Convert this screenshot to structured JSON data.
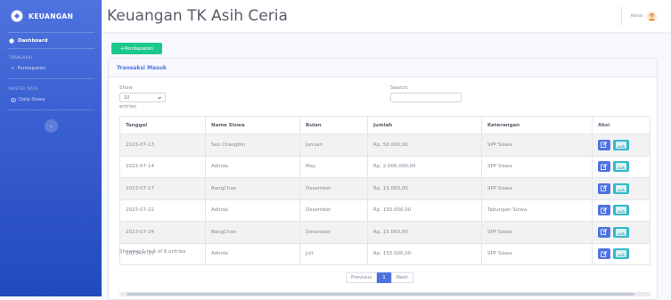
{
  "brand": {
    "name": "KEUANGAN"
  },
  "sidebar": {
    "dashboard": "Dashboard",
    "heading_transaksi": "TRANSAKSI",
    "pendapatan": "Pendapatan",
    "heading_master": "MASTER DATA",
    "data_siswa": "Data Siswa",
    "toggle_icon": "chevron-left"
  },
  "header": {
    "title": "Keuangan TK Asih Ceria",
    "user": "Admin"
  },
  "toolbar": {
    "add_label": "+Pendapatan"
  },
  "card": {
    "title": "Transaksi Masuk"
  },
  "controls": {
    "show_label": "Show",
    "length_value": "10",
    "entries_label": "entries",
    "search_label": "Search:"
  },
  "table": {
    "headers": [
      "Tanggal",
      "Nama Siswa",
      "Bulan",
      "Jumlah",
      "Keterangan",
      "Aksi"
    ],
    "rows": [
      [
        "2023-07-13",
        "Seo Changbin",
        "Januari",
        "Rp. 50.000,00",
        "SPP Siswa"
      ],
      [
        "2023-07-14",
        "Adinda",
        "May",
        "Rp. 2.000.000,00",
        "SPP Siswa"
      ],
      [
        "2023-07-17",
        "BangChan",
        "Desember",
        "Rp. 15.000,00",
        "SPP Siswa"
      ],
      [
        "2023-07-22",
        "Adinda",
        "Desember",
        "Rp. 150.000,00",
        "Tabungan Siswa"
      ],
      [
        "2023-07-24",
        "BangChan",
        "Desember",
        "Rp. 15.000,00",
        "SPP Siswa"
      ],
      [
        "2023-07-25",
        "Adinda",
        "Juli",
        "Rp. 150.000,00",
        "SPP Siswa"
      ]
    ]
  },
  "footer": {
    "info": "Showing 1 to 6 of 6 entries",
    "previous": "Previous",
    "page": "1",
    "next": "Next"
  },
  "colors": {
    "primary": "#4e73df",
    "success": "#1cc88a",
    "info": "#36b9cc"
  }
}
